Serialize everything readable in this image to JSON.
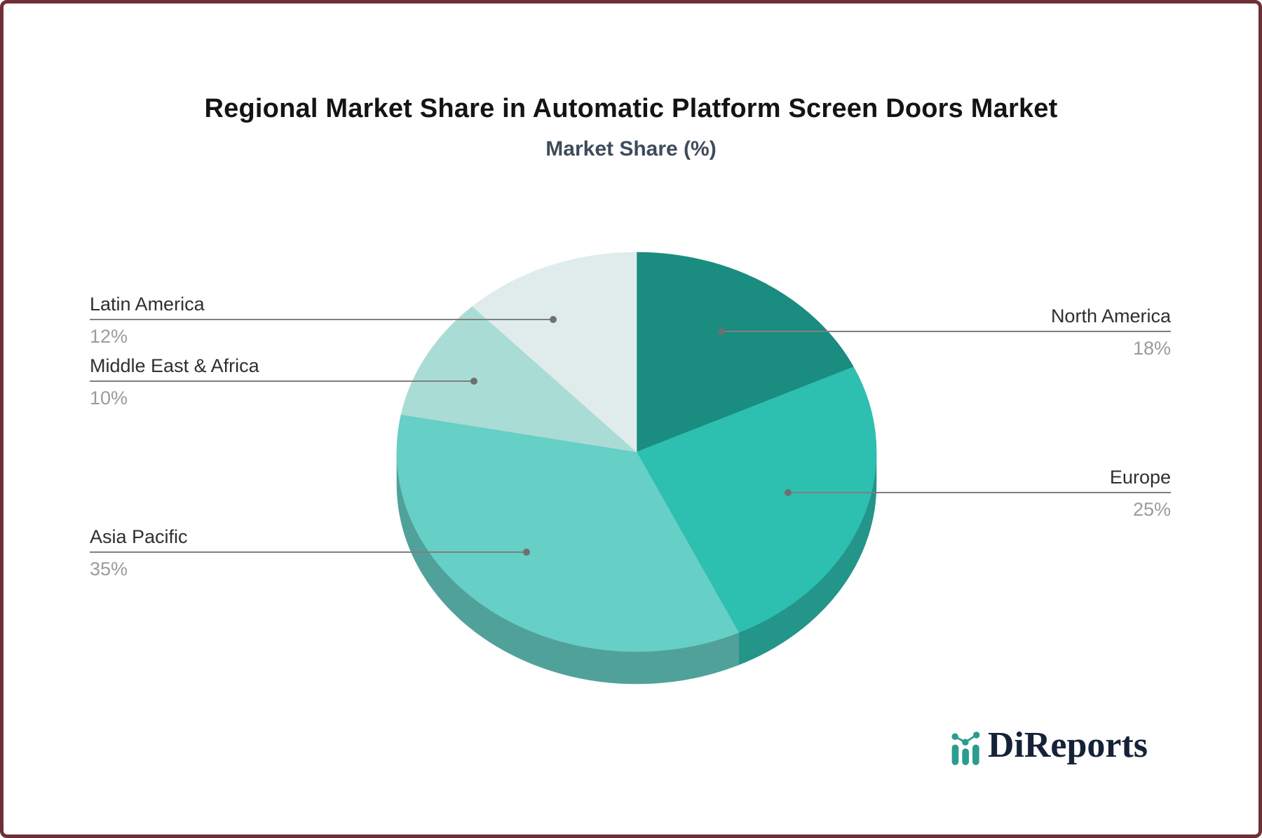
{
  "chart_data": {
    "type": "pie",
    "style": "3d",
    "title": "Regional Market Share in Automatic Platform Screen Doors Market",
    "subtitle": "Market Share (%)",
    "unit": "%",
    "start_angle_deg": 0,
    "direction": "clockwise",
    "categories": [
      "North America",
      "Europe",
      "Asia Pacific",
      "Middle East & Africa",
      "Latin America"
    ],
    "values": [
      18,
      25,
      35,
      10,
      12
    ],
    "slices": [
      {
        "label": "North America",
        "value": 18,
        "pct_label": "18%",
        "color": "#1A8C80",
        "side": "right"
      },
      {
        "label": "Europe",
        "value": 25,
        "pct_label": "25%",
        "color": "#2DBFB0",
        "side": "right"
      },
      {
        "label": "Asia Pacific",
        "value": 35,
        "pct_label": "35%",
        "color": "#66CFC6",
        "side": "left"
      },
      {
        "label": "Middle East & Africa",
        "value": 10,
        "pct_label": "10%",
        "color": "#A9DCD5",
        "side": "left"
      },
      {
        "label": "Latin America",
        "value": 12,
        "pct_label": "12%",
        "color": "#DFECEB",
        "side": "left"
      }
    ],
    "legend": "none",
    "leader_line_color": "#7f7f7f",
    "label_color": "#2f2f2f",
    "pct_color": "#9b9b9b"
  },
  "branding": {
    "logo_text": "DiReports",
    "logo_color": "#152238",
    "logo_icon": "bar-chart-trend-icon",
    "logo_icon_color": "#2B9C90"
  }
}
